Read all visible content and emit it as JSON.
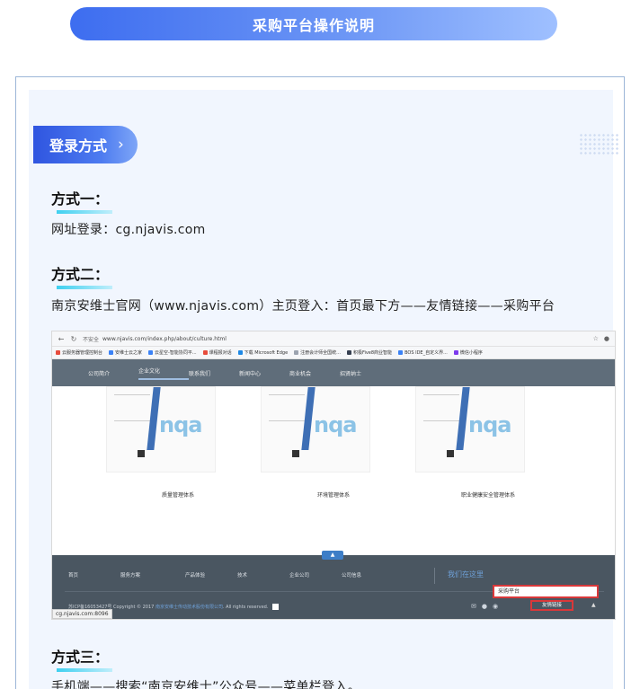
{
  "banner": {
    "title": "采购平台操作说明"
  },
  "section": {
    "title": "登录方式",
    "chevron": "›"
  },
  "methods": [
    {
      "heading": "方式一：",
      "text": "网址登录：cg.njavis.com"
    },
    {
      "heading": "方式二：",
      "text": "南京安维士官网（www.njavis.com）主页登入：首页最下方——友情链接——采购平台"
    },
    {
      "heading": "方式三：",
      "text": "手机端——搜索“南京安维士”公众号——菜单栏登入。"
    }
  ],
  "screenshot": {
    "address": {
      "warning": "不安全",
      "url": "www.njavis.com/index.php/about/culture.html"
    },
    "bookmarks": [
      {
        "label": "云服务器管理控制台",
        "color": "#e74c3c"
      },
      {
        "label": "安维士云之家",
        "color": "#3b82f6"
      },
      {
        "label": "云星空-智能协同平...",
        "color": "#3b82f6"
      },
      {
        "label": "课程报对话",
        "color": "#e74c3c"
      },
      {
        "label": "下载 Microsoft Edge",
        "color": "#1e88e5"
      },
      {
        "label": "注册会计师全国统...",
        "color": "#9ca3af"
      },
      {
        "label": "积极Five8商业智能",
        "color": "#374151"
      },
      {
        "label": "BOS IDE_自定义界...",
        "color": "#3b82f6"
      },
      {
        "label": "微信小程序",
        "color": "#7c3aed"
      }
    ],
    "nav": [
      "公司简介",
      "企业文化",
      "联系我们",
      "新闻中心",
      "商业机会",
      "招贤纳士"
    ],
    "nav_active_index": 1,
    "certificates": [
      {
        "brand": "nqa",
        "label": "质量管理体系"
      },
      {
        "brand": "nqa",
        "label": "环境管理体系"
      },
      {
        "brand": "nqa",
        "label": "职业健康安全管理体系"
      }
    ],
    "footer": {
      "links": [
        "首页",
        "服务方案",
        "产品体验",
        "技术",
        "企业公司",
        "公司信息"
      ],
      "find_us": "我们在这里",
      "procurement": "采购平台",
      "copyright": "苏ICP备16053427号 Copyright © 2017",
      "company_link": "南京安维士传动技术股份有限公司",
      "rights": ". All rights reserved.",
      "friend_links": "友情链接",
      "status_url": "cg.njavis.com:8096"
    }
  }
}
